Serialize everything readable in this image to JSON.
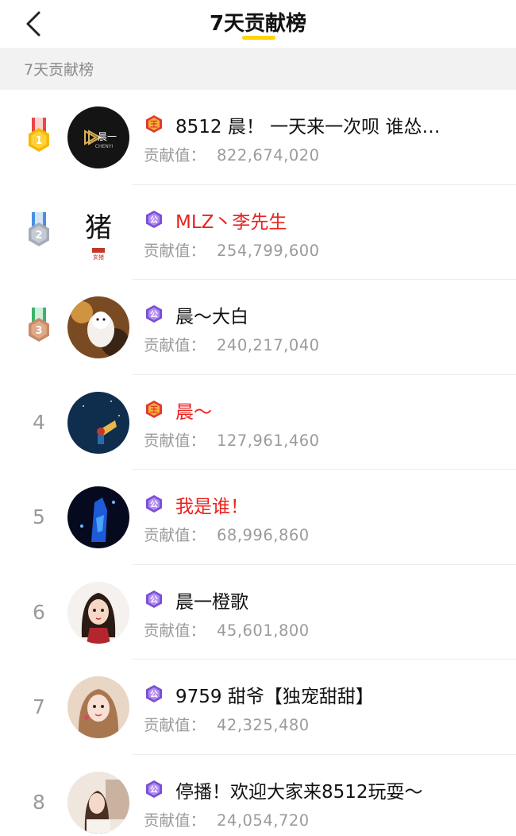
{
  "header": {
    "title": "7天贡献榜"
  },
  "section": {
    "label": "7天贡献榜"
  },
  "contrib_label": "贡献值：",
  "avatar_texts": {
    "row1_logo": "晨一",
    "row1_logo_sub": "CHENYI",
    "row2_char": "猪",
    "row2_sub": "亥猪"
  },
  "colors": {
    "accent": "#ffd400",
    "highlight_name": "#e8231f",
    "king_badge": "#e03a2f",
    "duke_badge": "#7b4fd6"
  },
  "rows": [
    {
      "rank": "1",
      "medal": "gold",
      "badge": "king",
      "badge_text": "王",
      "name": "8512 晨！ 一天来一次呗 谁怂…",
      "name_highlight": false,
      "value": "822,674,020"
    },
    {
      "rank": "2",
      "medal": "silver",
      "badge": "duke",
      "badge_text": "公",
      "name": "MLZ丶李先生",
      "name_highlight": true,
      "value": "254,799,600"
    },
    {
      "rank": "3",
      "medal": "bronze",
      "badge": "duke",
      "badge_text": "公",
      "name": "晨～大白",
      "name_highlight": false,
      "value": "240,217,040"
    },
    {
      "rank": "4",
      "medal": null,
      "badge": "king",
      "badge_text": "王",
      "name": "晨～",
      "name_highlight": true,
      "value": "127,961,460"
    },
    {
      "rank": "5",
      "medal": null,
      "badge": "duke",
      "badge_text": "公",
      "name": "我是谁！",
      "name_highlight": true,
      "value": "68,996,860"
    },
    {
      "rank": "6",
      "medal": null,
      "badge": "duke",
      "badge_text": "公",
      "name": "晨一橙歌",
      "name_highlight": false,
      "value": "45,601,800"
    },
    {
      "rank": "7",
      "medal": null,
      "badge": "duke",
      "badge_text": "公",
      "name": "9759 甜爷【独宠甜甜】",
      "name_highlight": false,
      "value": "42,325,480"
    },
    {
      "rank": "8",
      "medal": null,
      "badge": "duke",
      "badge_text": "公",
      "name": "停播！欢迎大家来8512玩耍～",
      "name_highlight": false,
      "value": "24,054,720"
    }
  ]
}
